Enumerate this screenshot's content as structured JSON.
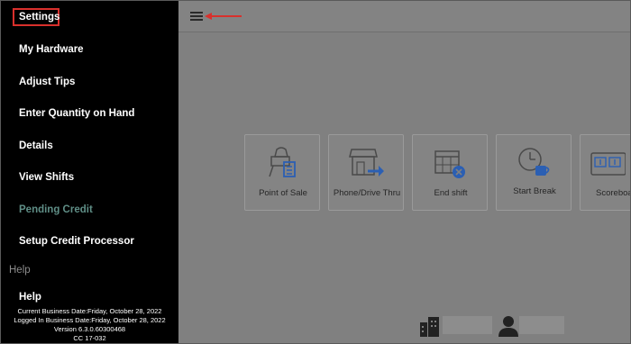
{
  "sidebar": {
    "items": [
      {
        "label": "Settings"
      },
      {
        "label": "My Hardware"
      },
      {
        "label": "Adjust Tips"
      },
      {
        "label": "Enter Quantity on Hand"
      },
      {
        "label": "Details"
      },
      {
        "label": "View Shifts"
      },
      {
        "label": "Pending Credit"
      },
      {
        "label": "Setup Credit Processor"
      }
    ],
    "section_label": "Help",
    "help_label": "Help",
    "info": {
      "current_business_date": "Current Business Date:Friday, October 28, 2022",
      "logged_in_business_date": "Logged In Business Date:Friday, October 28, 2022",
      "version": "Version 6.3.0.60300468",
      "cc": "CC 17-032"
    }
  },
  "main": {
    "tiles": [
      {
        "label": "Point of Sale",
        "icon": "point-of-sale-icon"
      },
      {
        "label": "Phone/Drive Thru",
        "icon": "storefront-arrow-icon"
      },
      {
        "label": "End shift",
        "icon": "calendar-close-icon"
      },
      {
        "label": "Start Break",
        "icon": "clock-coffee-icon"
      },
      {
        "label": "Scoreboard",
        "icon": "scoreboard-icon"
      }
    ]
  },
  "colors": {
    "sidebar_bg": "#000000",
    "main_bg": "#808080",
    "highlight_box": "#d9302c",
    "pending_text": "#5f8e86",
    "icon_blue": "#2b5fb3"
  }
}
